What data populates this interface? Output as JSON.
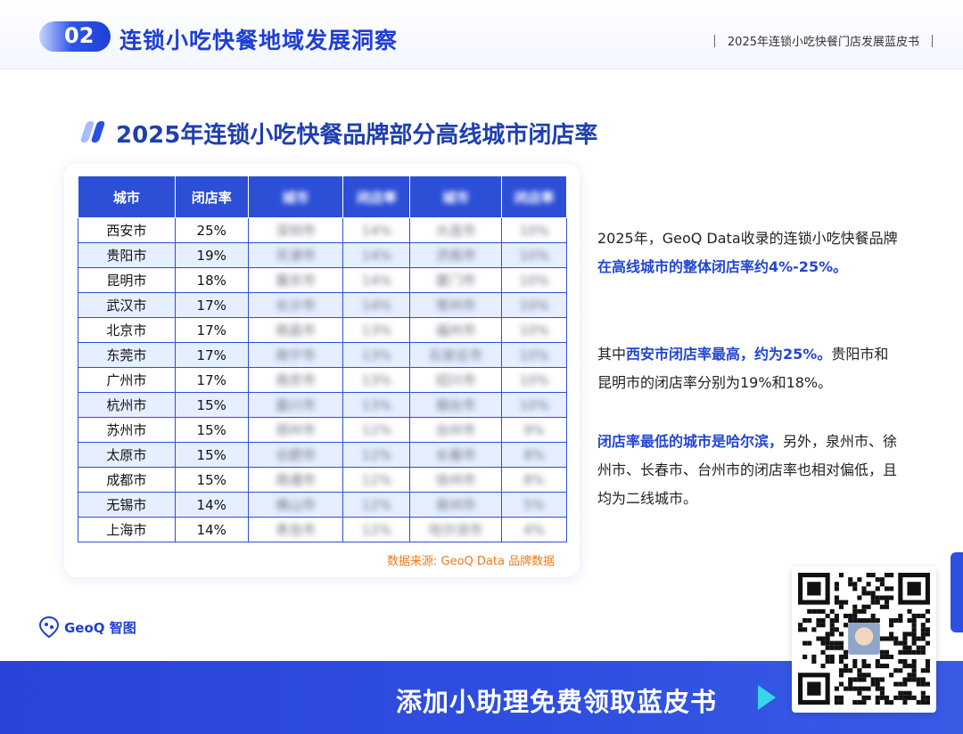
{
  "header": {
    "section_number": "02",
    "section_title": "连锁小吃快餐地域发展洞察",
    "report_name": "2025年连锁小吃快餐门店发展蓝皮书"
  },
  "page_title": "2025年连锁小吃快餐品牌部分高线城市闭店率",
  "table": {
    "headers": [
      "城市",
      "闭店率",
      "城市",
      "闭店率",
      "城市",
      "闭店率"
    ],
    "rows": [
      [
        "西安市",
        "25%",
        "深圳市",
        "14%",
        "大连市",
        "10%"
      ],
      [
        "贵阳市",
        "19%",
        "天津市",
        "14%",
        "济南市",
        "10%"
      ],
      [
        "昆明市",
        "18%",
        "重庆市",
        "14%",
        "厦门市",
        "10%"
      ],
      [
        "武汉市",
        "17%",
        "长沙市",
        "14%",
        "常州市",
        "10%"
      ],
      [
        "北京市",
        "17%",
        "南昌市",
        "13%",
        "福州市",
        "10%"
      ],
      [
        "东莞市",
        "17%",
        "南宁市",
        "13%",
        "石家庄市",
        "10%"
      ],
      [
        "广州市",
        "17%",
        "南京市",
        "13%",
        "绍兴市",
        "10%"
      ],
      [
        "杭州市",
        "15%",
        "嘉兴市",
        "13%",
        "烟台市",
        "10%"
      ],
      [
        "苏州市",
        "15%",
        "郑州市",
        "12%",
        "台州市",
        "9%"
      ],
      [
        "太原市",
        "15%",
        "合肥市",
        "12%",
        "长春市",
        "8%"
      ],
      [
        "成都市",
        "15%",
        "南通市",
        "12%",
        "徐州市",
        "8%"
      ],
      [
        "无锡市",
        "14%",
        "佛山市",
        "12%",
        "泉州市",
        "5%"
      ],
      [
        "上海市",
        "14%",
        "青岛市",
        "12%",
        "哈尔滨市",
        "4%"
      ]
    ]
  },
  "source": "数据来源: GeoQ Data 品牌数据",
  "paragraphs": {
    "p1_a": "2025年，GeoQ Data收录的连锁小吃快餐品牌",
    "p1_hl": "在高线城市的整体闭店率约4%-25%。",
    "p2_a": "其中",
    "p2_hl": "西安市闭店率最高，约为25%。",
    "p2_b": "贵阳市和昆明市的闭店率分别为19%和18%。",
    "p3_hl": "闭店率最低的城市是哈尔滨，",
    "p3_b": "另外，泉州市、徐州市、长春市、台州市的闭店率也相对偏低，且均为二线城市。"
  },
  "logo": {
    "text": "GeoQ 智图"
  },
  "banner": {
    "cta": "添加小助理免费领取蓝皮书"
  },
  "colors": {
    "brand_blue": "#2d4fd6",
    "highlight": "#2246d4",
    "source_orange": "#f07a1a",
    "row_alt": "#e6efff"
  },
  "icons": [
    "title-slash-icon",
    "geoq-logo-icon",
    "play-arrow-icon",
    "qr-code-icon"
  ]
}
